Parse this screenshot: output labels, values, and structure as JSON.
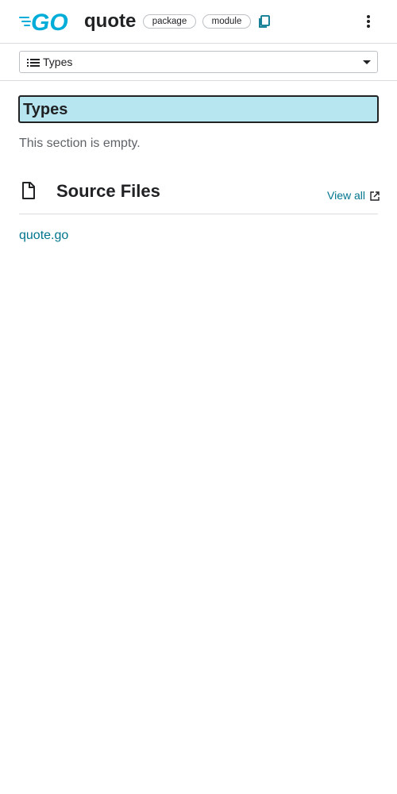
{
  "header": {
    "logo_text": "GO",
    "title": "quote",
    "chips": {
      "package": "package",
      "module": "module"
    },
    "icons": {
      "copy": "copy-icon",
      "menu": "more-vert-icon"
    }
  },
  "nav": {
    "selected": "Types",
    "icons": {
      "list": "list-icon",
      "caret": "caret-down-icon"
    }
  },
  "types_section": {
    "heading": "Types",
    "empty_message": "This section is empty."
  },
  "source_files": {
    "title": "Source Files",
    "view_all": "View all",
    "files": [
      "quote.go"
    ],
    "icons": {
      "file": "file-icon",
      "external": "external-link-icon"
    }
  },
  "colors": {
    "go_brand": "#00add8",
    "link": "#00758d",
    "highlight": "#b7e6f1",
    "muted_text": "#5f6368",
    "border": "#dadce0"
  }
}
